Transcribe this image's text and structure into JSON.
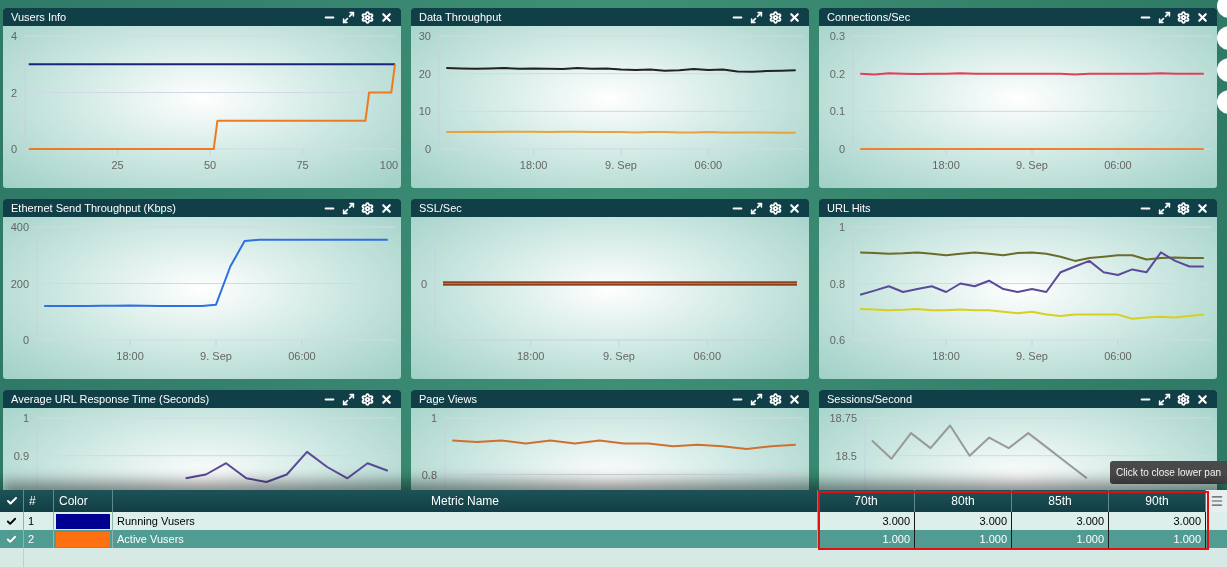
{
  "panels": [
    {
      "title": "Vusers Info",
      "chart_data": {
        "type": "line",
        "x": [
          1,
          51,
          52,
          92,
          93,
          99,
          100
        ],
        "xlim": [
          0,
          100
        ],
        "ylim": [
          0,
          4
        ],
        "yticks": [
          0,
          2,
          4
        ],
        "xticks": [
          25,
          50,
          75,
          100
        ],
        "series": [
          {
            "color": "#1a237e",
            "values": [
              3,
              3,
              3,
              3,
              3,
              3,
              3
            ]
          },
          {
            "color": "#f07a20",
            "values": [
              0,
              0,
              1,
              1,
              2,
              2,
              3
            ]
          }
        ]
      }
    },
    {
      "title": "Data Throughput",
      "chart_data": {
        "type": "line",
        "categories": [
          null,
          null,
          null,
          null,
          null,
          null,
          "18:00",
          null,
          null,
          null,
          null,
          null,
          "9. Sep",
          null,
          null,
          null,
          null,
          null,
          "06:00",
          null,
          null,
          null,
          null,
          null,
          null
        ],
        "ylim": [
          0,
          30
        ],
        "yticks": [
          0,
          10,
          20,
          30
        ],
        "series": [
          {
            "color": "#222222",
            "values": [
              21.5,
              21.4,
              21.3,
              21.4,
              21.5,
              21.3,
              21.4,
              21.3,
              21.2,
              21.5,
              21.3,
              21.4,
              21.1,
              21.0,
              21.1,
              20.8,
              20.9,
              21.2,
              21.0,
              21.1,
              20.6,
              20.5,
              20.7,
              20.8,
              20.9
            ]
          },
          {
            "color": "#e8a33a",
            "values": [
              4.5,
              4.5,
              4.6,
              4.5,
              4.6,
              4.6,
              4.6,
              4.5,
              4.6,
              4.6,
              4.5,
              4.5,
              4.5,
              4.4,
              4.5,
              4.5,
              4.4,
              4.4,
              4.5,
              4.4,
              4.4,
              4.4,
              4.4,
              4.3,
              4.3
            ]
          }
        ]
      }
    },
    {
      "title": "Connections/Sec",
      "chart_data": {
        "type": "line",
        "categories": [
          null,
          null,
          null,
          null,
          null,
          null,
          "18:00",
          null,
          null,
          null,
          null,
          null,
          "9. Sep",
          null,
          null,
          null,
          null,
          null,
          "06:00",
          null,
          null,
          null,
          null,
          null,
          null
        ],
        "ylim": [
          0,
          0.3
        ],
        "yticks": [
          0,
          0.1,
          0.2,
          0.3
        ],
        "series": [
          {
            "color": "#e0405a",
            "values": [
              0.2,
              0.198,
              0.201,
              0.2,
              0.199,
              0.2,
              0.2,
              0.201,
              0.2,
              0.2,
              0.2,
              0.2,
              0.2,
              0.2,
              0.2,
              0.198,
              0.2,
              0.2,
              0.2,
              0.2,
              0.2,
              0.201,
              0.2,
              0.2,
              0.2
            ]
          },
          {
            "color": "#f08030",
            "values": [
              0,
              0,
              0,
              0,
              0,
              0,
              0,
              0,
              0,
              0,
              0,
              0,
              0,
              0,
              0,
              0,
              0,
              0,
              0,
              0,
              0,
              0,
              0,
              0,
              0
            ]
          }
        ]
      }
    },
    {
      "title": "Ethernet Send Throughput (Kbps)",
      "chart_data": {
        "type": "line",
        "categories": [
          null,
          null,
          null,
          null,
          null,
          null,
          "18:00",
          null,
          null,
          null,
          null,
          null,
          "9. Sep",
          null,
          null,
          null,
          null,
          null,
          "06:00",
          null,
          null,
          null,
          null,
          null,
          null
        ],
        "ylim": [
          0,
          400
        ],
        "yticks": [
          0,
          200,
          400
        ],
        "series": [
          {
            "color": "#2f6fe0",
            "values": [
              120,
              120,
              120,
              120,
              121,
              121,
              122,
              121,
              120,
              120,
              120,
              120,
              125,
              260,
              350,
              355,
              355,
              355,
              355,
              355,
              355,
              355,
              355,
              355,
              355
            ]
          }
        ]
      }
    },
    {
      "title": "SSL/Sec",
      "plot": {
        "y_label": "0",
        "x_labels": [
          "18:00",
          "9. Sep",
          "06:00"
        ]
      }
    },
    {
      "title": "URL Hits",
      "chart_data": {
        "type": "line",
        "categories": [
          null,
          null,
          null,
          null,
          null,
          null,
          "18:00",
          null,
          null,
          null,
          null,
          null,
          "9. Sep",
          null,
          null,
          null,
          null,
          null,
          "06:00",
          null,
          null,
          null,
          null,
          null,
          null
        ],
        "ylim": [
          0.6,
          1
        ],
        "yticks": [
          0.6,
          0.8,
          1
        ],
        "series": [
          {
            "color": "#6b6b2a",
            "values": [
              0.91,
              0.908,
              0.905,
              0.907,
              0.91,
              0.905,
              0.9,
              0.905,
              0.91,
              0.905,
              0.9,
              0.908,
              0.91,
              0.905,
              0.895,
              0.88,
              0.89,
              0.895,
              0.9,
              0.9,
              0.885,
              0.89,
              0.892,
              0.89,
              0.89
            ]
          },
          {
            "color": "#5a4a9a",
            "values": [
              0.76,
              0.775,
              0.79,
              0.77,
              0.78,
              0.79,
              0.77,
              0.8,
              0.79,
              0.81,
              0.78,
              0.77,
              0.78,
              0.77,
              0.84,
              0.86,
              0.88,
              0.84,
              0.83,
              0.85,
              0.84,
              0.91,
              0.88,
              0.86,
              0.86
            ]
          },
          {
            "color": "#d8d020",
            "values": [
              0.71,
              0.708,
              0.705,
              0.707,
              0.71,
              0.705,
              0.705,
              0.708,
              0.705,
              0.705,
              0.7,
              0.695,
              0.7,
              0.69,
              0.685,
              0.69,
              0.69,
              0.69,
              0.69,
              0.675,
              0.68,
              0.682,
              0.68,
              0.685,
              0.69
            ]
          }
        ]
      }
    },
    {
      "title": "Average URL Response Time (Seconds)",
      "chart_data": {
        "type": "line",
        "categories": [
          null,
          null,
          null,
          null,
          null,
          null,
          null,
          null,
          null,
          null,
          null,
          null,
          null,
          null,
          null,
          null,
          null,
          null
        ],
        "ylim": [
          0.7,
          1
        ],
        "yticks": [
          0.9,
          1
        ],
        "series": [
          {
            "color": "#5a4a9a",
            "values": [
              null,
              null,
              null,
              null,
              null,
              null,
              null,
              0.84,
              0.85,
              0.88,
              0.84,
              0.83,
              0.85,
              0.91,
              0.87,
              0.84,
              0.88,
              0.86
            ]
          }
        ]
      }
    },
    {
      "title": "Page Views",
      "chart_data": {
        "type": "line",
        "categories": [
          null,
          null,
          null,
          null,
          null,
          null,
          null,
          null,
          null,
          null,
          null,
          null,
          null,
          null,
          null
        ],
        "ylim": [
          0.6,
          1
        ],
        "yticks": [
          0.8,
          1
        ],
        "series": [
          {
            "color": "#d07030",
            "values": [
              0.92,
              0.915,
              0.92,
              0.91,
              0.92,
              0.91,
              0.92,
              0.91,
              0.91,
              0.9,
              0.905,
              0.9,
              0.89,
              0.9,
              0.905
            ]
          }
        ]
      }
    },
    {
      "title": "Sessions/Second",
      "chart_data": {
        "type": "line",
        "categories": [
          null,
          null,
          null,
          null,
          null,
          null,
          null,
          null,
          null,
          null,
          null,
          null,
          null,
          null,
          null,
          null,
          null,
          null
        ],
        "ylim": [
          18,
          18.75
        ],
        "yticks": [
          18.5,
          18.75
        ],
        "series": [
          {
            "color": "#999999",
            "values": [
              18.6,
              18.48,
              18.65,
              18.55,
              18.7,
              18.5,
              18.62,
              18.55,
              18.65,
              18.55,
              18.45,
              18.35,
              null,
              null,
              null,
              null,
              null,
              null
            ]
          }
        ]
      }
    }
  ],
  "tooltip": "Click to close lower pan",
  "table": {
    "columns": [
      "#",
      "Color",
      "Metric Name",
      "70th",
      "80th",
      "85th",
      "90th"
    ],
    "rows": [
      {
        "checked": true,
        "selected": false,
        "index": "1",
        "color": "#000090",
        "name": "Running Vusers",
        "values": [
          "3.000",
          "3.000",
          "3.000",
          "3.000"
        ]
      },
      {
        "checked": true,
        "selected": true,
        "index": "2",
        "color": "#ff7010",
        "name": "Active Vusers",
        "values": [
          "1.000",
          "1.000",
          "1.000",
          "1.000"
        ]
      }
    ]
  }
}
